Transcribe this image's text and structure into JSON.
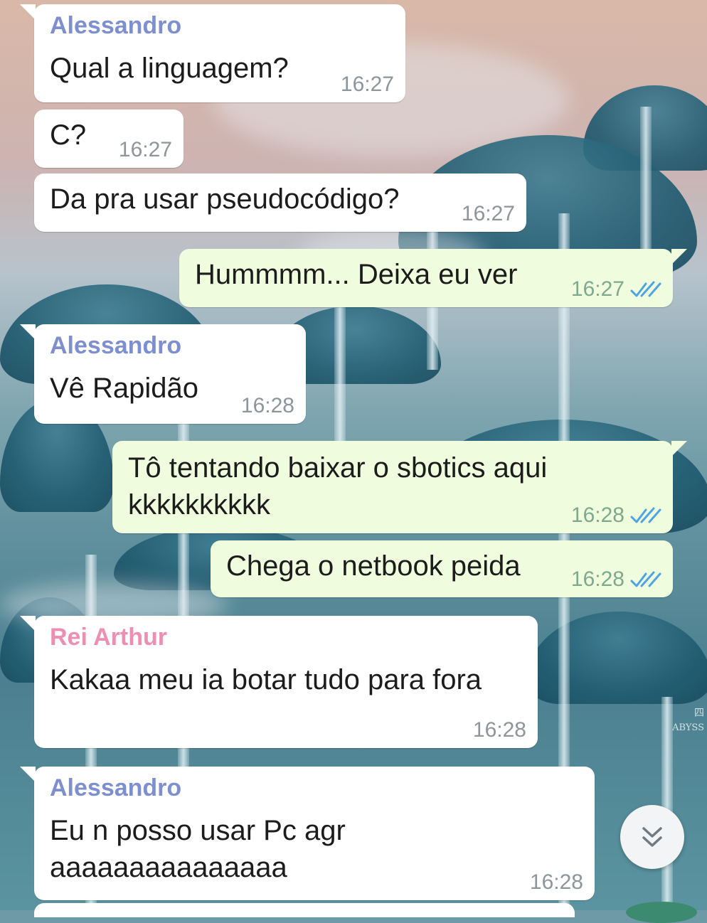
{
  "colors": {
    "alessandro": "#7e8fcf",
    "rei_arthur": "#ec8fb3",
    "incoming_bg": "#ffffff",
    "outgoing_bg": "#effdde",
    "read_check": "#4fa5e3"
  },
  "messages": [
    {
      "sender": "Alessandro",
      "text": "Qual a linguagem?",
      "time": "16:27"
    },
    {
      "text": "C?",
      "time": "16:27"
    },
    {
      "text": "Da pra usar pseudocódigo?",
      "time": "16:27"
    },
    {
      "text": "Hummmm... Deixa eu ver",
      "time": "16:27",
      "status": "read"
    },
    {
      "sender": "Alessandro",
      "text": "Vê Rapidão",
      "time": "16:28"
    },
    {
      "text": "Tô tentando baixar o sbotics aqui\nkkkkkkkkkk",
      "time": "16:28",
      "status": "read"
    },
    {
      "text": "Chega o netbook peida",
      "time": "16:28",
      "status": "read"
    },
    {
      "sender": "Rei Arthur",
      "text": "Kakaa meu ia botar tudo para fora",
      "time": "16:28"
    },
    {
      "sender": "Alessandro",
      "text": "Eu n posso usar Pc agr\naaaaaaaaaaaaaaa",
      "time": "16:28"
    }
  ],
  "scroll_button": {
    "icon": "double-chevron-down-icon"
  },
  "wallpaper_text": {
    "line1": "四",
    "line2": "ABYSS"
  }
}
